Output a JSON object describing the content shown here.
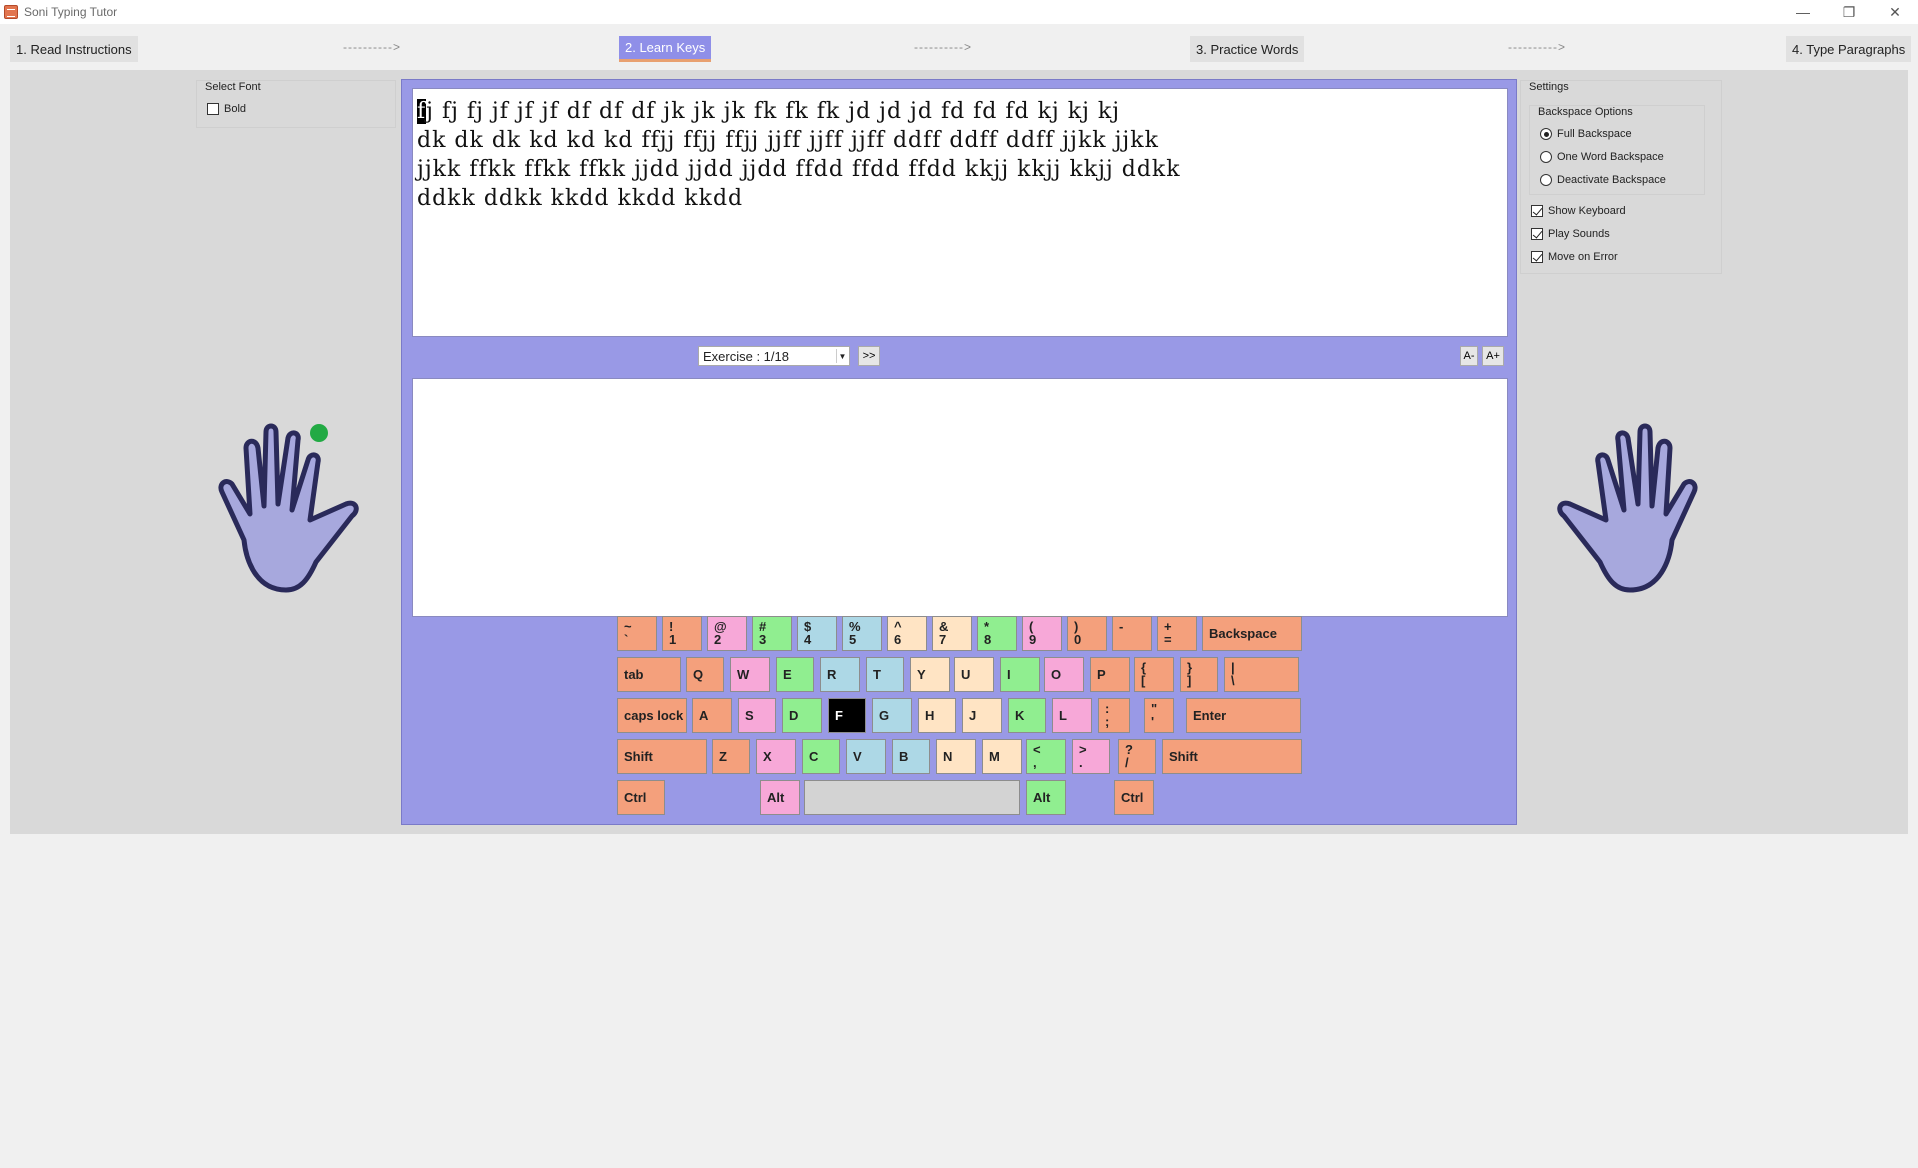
{
  "window": {
    "title": "Soni Typing Tutor",
    "minimize": "—",
    "restore": "❐",
    "close": "✕"
  },
  "steps": [
    {
      "label": "1. Read Instructions"
    },
    {
      "label": "2. Learn Keys"
    },
    {
      "label": "3. Practice Words"
    },
    {
      "label": "4. Type Paragraphs"
    }
  ],
  "arrow_text": "---------->",
  "font_panel": {
    "title": "Select Font",
    "bold_label": "Bold",
    "bold_checked": false
  },
  "settings": {
    "title": "Settings",
    "backspace_title": "Backspace Options",
    "backspace_options": [
      "Full Backspace",
      "One Word Backspace",
      "Deactivate Backspace"
    ],
    "selected_backspace": 0,
    "checkboxes": [
      {
        "label": "Show Keyboard",
        "checked": true
      },
      {
        "label": "Play Sounds",
        "checked": true
      },
      {
        "label": "Move on Error",
        "checked": true
      }
    ]
  },
  "exercise": {
    "cursor_char": "f",
    "lines": [
      "j fj fj jf jf jf df df df jk jk jk fk fk fk jd jd jd fd fd fd kj kj kj",
      "dk dk dk kd kd kd ffjj ffjj ffjj jjff jjff jjff ddff ddff ddff jjkk jjkk",
      "jjkk ffkk ffkk ffkk jjdd jjdd jjdd ffdd ffdd ffdd kkjj kkjj kkjj ddkk",
      "ddkk ddkk kkdd kkdd kkdd"
    ],
    "selector": "Exercise : 1/18",
    "next_label": ">>",
    "font_smaller": "A-",
    "font_larger": "A+",
    "typed_text": ""
  },
  "keyboard": {
    "row1": [
      {
        "top": "~",
        "bot": "`",
        "color": "orange"
      },
      {
        "top": "!",
        "bot": "1",
        "color": "orange"
      },
      {
        "top": "@",
        "bot": "2",
        "color": "pink"
      },
      {
        "top": "#",
        "bot": "3",
        "color": "green"
      },
      {
        "top": "$",
        "bot": "4",
        "color": "blue"
      },
      {
        "top": "%",
        "bot": "5",
        "color": "blue"
      },
      {
        "top": "^",
        "bot": "6",
        "color": "cream"
      },
      {
        "top": "&",
        "bot": "7",
        "color": "cream"
      },
      {
        "top": "*",
        "bot": "8",
        "color": "green"
      },
      {
        "top": "(",
        "bot": "9",
        "color": "pink"
      },
      {
        "top": ")",
        "bot": "0",
        "color": "orange"
      },
      {
        "top": "",
        "bot": "-",
        "color": "orange"
      },
      {
        "top": "+",
        "bot": "=",
        "color": "orange"
      },
      {
        "label": "Backspace",
        "color": "orange"
      }
    ],
    "row2": [
      {
        "label": "tab",
        "color": "orange"
      },
      {
        "label": "Q",
        "color": "orange"
      },
      {
        "label": "W",
        "color": "pink"
      },
      {
        "label": "E",
        "color": "green"
      },
      {
        "label": "R",
        "color": "blue"
      },
      {
        "label": "T",
        "color": "blue"
      },
      {
        "label": "Y",
        "color": "cream"
      },
      {
        "label": "U",
        "color": "cream"
      },
      {
        "label": "I",
        "color": "green"
      },
      {
        "label": "O",
        "color": "pink"
      },
      {
        "label": "P",
        "color": "orange"
      },
      {
        "top": "{",
        "bot": "[",
        "color": "orange"
      },
      {
        "top": "}",
        "bot": "]",
        "color": "orange"
      },
      {
        "top": "|",
        "bot": "\\",
        "color": "orange"
      }
    ],
    "row3": [
      {
        "label": "caps lock",
        "color": "orange"
      },
      {
        "label": "A",
        "color": "orange"
      },
      {
        "label": "S",
        "color": "pink"
      },
      {
        "label": "D",
        "color": "green"
      },
      {
        "label": "F",
        "color": "black"
      },
      {
        "label": "G",
        "color": "blue"
      },
      {
        "label": "H",
        "color": "cream"
      },
      {
        "label": "J",
        "color": "cream"
      },
      {
        "label": "K",
        "color": "green"
      },
      {
        "label": "L",
        "color": "pink"
      },
      {
        "top": ":",
        "bot": ";",
        "color": "orange"
      },
      {
        "top": "\"",
        "bot": "'",
        "color": "orange"
      },
      {
        "label": "Enter",
        "color": "orange"
      }
    ],
    "row4": [
      {
        "label": "Shift",
        "color": "orange"
      },
      {
        "label": "Z",
        "color": "orange"
      },
      {
        "label": "X",
        "color": "pink"
      },
      {
        "label": "C",
        "color": "green"
      },
      {
        "label": "V",
        "color": "blue"
      },
      {
        "label": "B",
        "color": "blue"
      },
      {
        "label": "N",
        "color": "cream"
      },
      {
        "label": "M",
        "color": "cream"
      },
      {
        "top": "<",
        "bot": ",",
        "color": "green"
      },
      {
        "top": ">",
        "bot": ".",
        "color": "pink"
      },
      {
        "top": "?",
        "bot": "/",
        "color": "orange"
      },
      {
        "label": "Shift",
        "color": "orange"
      }
    ],
    "row5": [
      {
        "label": "Ctrl",
        "color": "orange"
      },
      {
        "label": "Alt",
        "color": "pink"
      },
      {
        "label": "",
        "color": "space"
      },
      {
        "label": "Alt",
        "color": "green"
      },
      {
        "label": "Ctrl",
        "color": "orange"
      }
    ]
  },
  "colors": {
    "panel": "#9999e6",
    "active_tab": "#8f8fe8",
    "hand": "#a7a8dd",
    "finger_marker": "#22aa44"
  },
  "icons": {
    "app": "typing-tutor-icon",
    "finger_marker": "green-dot-icon"
  }
}
